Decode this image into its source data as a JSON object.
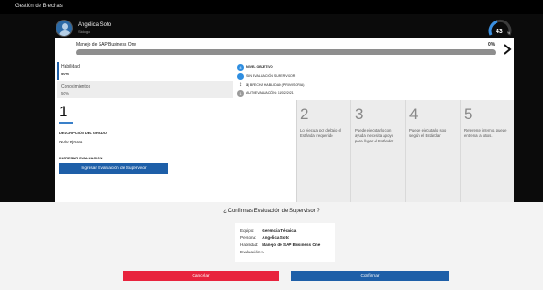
{
  "app": {
    "title": "Gestión de Brechas"
  },
  "user": {
    "name": "Angelica Soto",
    "role": "Sinlogo"
  },
  "score": {
    "value": "43",
    "suffix": "%"
  },
  "course": {
    "title": "Manejo de SAP Business One",
    "percent_text": "0%",
    "progress": 0.0
  },
  "categories": {
    "habilidad": {
      "label": "Habilidad",
      "percent": "50%"
    },
    "conocimientos": {
      "label": "Conocimientos",
      "percent": "50%"
    }
  },
  "legend": [
    {
      "icon": "4",
      "text": "NIVEL OBJETIVO",
      "color": "#2f8ee0",
      "bold": true
    },
    {
      "icon": "",
      "text": "SIN EVALUACIÓN SUPERVISOR",
      "color": "#2f8ee0",
      "bold": false
    },
    {
      "icon": "↕",
      "strong": "3",
      "text": " | BRECHA HABILIDAD (PROVISORIA)",
      "color": "",
      "bold": false
    },
    {
      "icon": "1",
      "text": "AUTOEVALUACIÓN: 14/02/2021",
      "color": "#9a9a9a",
      "bold": false
    }
  ],
  "active_level": {
    "number": "1",
    "desc_header": "DESCRIPCIÓN DEL GRADO",
    "desc_text": "No lo ejecuta",
    "eval_header": "INGRESAR EVALUACIÓN",
    "eval_button": "Ingresar Evaluación de Supervisor"
  },
  "levels": [
    {
      "number": "2",
      "text": "Lo ejecuta por debajo el Estándar requerido"
    },
    {
      "number": "3",
      "text": "Puede ejecutarlo con ayuda, necesita apoyo para llegar al Estándar"
    },
    {
      "number": "4",
      "text": "Puede ejecutarlo solo según el Estándar"
    },
    {
      "number": "5",
      "text": "Referente interno, puede entrenar a otros."
    }
  ],
  "confirm": {
    "title": "¿ Confirmas Evaluación de Supervisor ?",
    "rows": [
      {
        "key": "Equipo:",
        "value": "Gerencia Técnica"
      },
      {
        "key": "Persona:",
        "value": "Angelica Soto"
      },
      {
        "key": "Habilidad:",
        "value": "Manejo de SAP Business One"
      },
      {
        "key": "Evaluación:",
        "value": "1"
      }
    ],
    "cancel": "Cancelar",
    "ok": "Confirmar"
  }
}
